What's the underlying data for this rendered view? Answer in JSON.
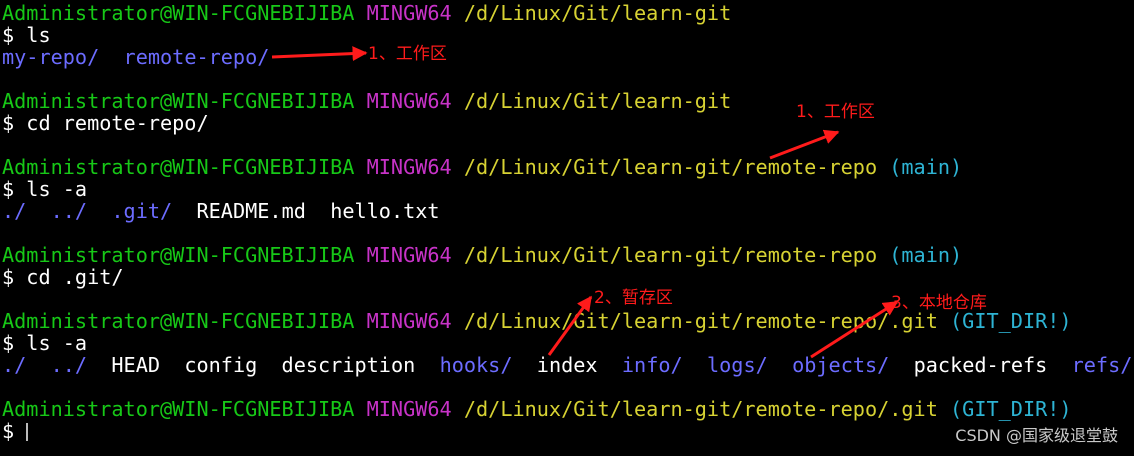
{
  "terminal": {
    "colors": {
      "background": "#000000",
      "default": "#ffffff",
      "user": "#17c817",
      "system": "#c833c8",
      "path": "#d7d233",
      "branch": "#2eb4d4",
      "dir": "#6c6cff"
    },
    "lines": [
      {
        "segments": [
          {
            "text": "Administrator@WIN-FCGNEBIJIBA",
            "color": "user"
          },
          {
            "text": " "
          },
          {
            "text": "MINGW64",
            "color": "system"
          },
          {
            "text": " "
          },
          {
            "text": "/d/Linux/Git/learn-git",
            "color": "path"
          }
        ]
      },
      {
        "segments": [
          {
            "text": "$ ls"
          }
        ]
      },
      {
        "segments": [
          {
            "text": "my-repo/",
            "color": "dir"
          },
          {
            "text": "  "
          },
          {
            "text": "remote-repo/",
            "color": "dir"
          }
        ]
      },
      {
        "segments": []
      },
      {
        "segments": [
          {
            "text": "Administrator@WIN-FCGNEBIJIBA",
            "color": "user"
          },
          {
            "text": " "
          },
          {
            "text": "MINGW64",
            "color": "system"
          },
          {
            "text": " "
          },
          {
            "text": "/d/Linux/Git/learn-git",
            "color": "path"
          }
        ]
      },
      {
        "segments": [
          {
            "text": "$ cd remote-repo/"
          }
        ]
      },
      {
        "segments": []
      },
      {
        "segments": [
          {
            "text": "Administrator@WIN-FCGNEBIJIBA",
            "color": "user"
          },
          {
            "text": " "
          },
          {
            "text": "MINGW64",
            "color": "system"
          },
          {
            "text": " "
          },
          {
            "text": "/d/Linux/Git/learn-git/remote-repo",
            "color": "path"
          },
          {
            "text": " "
          },
          {
            "text": "(main)",
            "color": "branch"
          }
        ]
      },
      {
        "segments": [
          {
            "text": "$ ls -a"
          }
        ]
      },
      {
        "segments": [
          {
            "text": "./",
            "color": "dir"
          },
          {
            "text": "  "
          },
          {
            "text": "../",
            "color": "dir"
          },
          {
            "text": "  "
          },
          {
            "text": ".git/",
            "color": "dir"
          },
          {
            "text": "  README.md  hello.txt"
          }
        ]
      },
      {
        "segments": []
      },
      {
        "segments": [
          {
            "text": "Administrator@WIN-FCGNEBIJIBA",
            "color": "user"
          },
          {
            "text": " "
          },
          {
            "text": "MINGW64",
            "color": "system"
          },
          {
            "text": " "
          },
          {
            "text": "/d/Linux/Git/learn-git/remote-repo",
            "color": "path"
          },
          {
            "text": " "
          },
          {
            "text": "(main)",
            "color": "branch"
          }
        ]
      },
      {
        "segments": [
          {
            "text": "$ cd .git/"
          }
        ]
      },
      {
        "segments": []
      },
      {
        "segments": [
          {
            "text": "Administrator@WIN-FCGNEBIJIBA",
            "color": "user"
          },
          {
            "text": " "
          },
          {
            "text": "MINGW64",
            "color": "system"
          },
          {
            "text": " "
          },
          {
            "text": "/d/Linux/Git/learn-git/remote-repo/.git",
            "color": "path"
          },
          {
            "text": " "
          },
          {
            "text": "(GIT_DIR!)",
            "color": "branch"
          }
        ]
      },
      {
        "segments": [
          {
            "text": "$ ls -a"
          }
        ]
      },
      {
        "segments": [
          {
            "text": "./",
            "color": "dir"
          },
          {
            "text": "  "
          },
          {
            "text": "../",
            "color": "dir"
          },
          {
            "text": "  HEAD  config  description  "
          },
          {
            "text": "hooks/",
            "color": "dir"
          },
          {
            "text": "  index  "
          },
          {
            "text": "info/",
            "color": "dir"
          },
          {
            "text": "  "
          },
          {
            "text": "logs/",
            "color": "dir"
          },
          {
            "text": "  "
          },
          {
            "text": "objects/",
            "color": "dir"
          },
          {
            "text": "  packed-refs  "
          },
          {
            "text": "refs/",
            "color": "dir"
          }
        ]
      },
      {
        "segments": []
      },
      {
        "segments": [
          {
            "text": "Administrator@WIN-FCGNEBIJIBA",
            "color": "user"
          },
          {
            "text": " "
          },
          {
            "text": "MINGW64",
            "color": "system"
          },
          {
            "text": " "
          },
          {
            "text": "/d/Linux/Git/learn-git/remote-repo/.git",
            "color": "path"
          },
          {
            "text": " "
          },
          {
            "text": "(GIT_DIR!)",
            "color": "branch"
          }
        ]
      },
      {
        "segments": [
          {
            "text": "$"
          }
        ],
        "cursor": true
      }
    ]
  },
  "annotations": {
    "color": "#ff1b1b",
    "items": [
      {
        "text": "1、工作区"
      },
      {
        "text": "1、工作区"
      },
      {
        "text": "2、暂存区"
      },
      {
        "text": "3、本地仓库"
      }
    ]
  },
  "watermark": "CSDN @国家级退堂鼓"
}
